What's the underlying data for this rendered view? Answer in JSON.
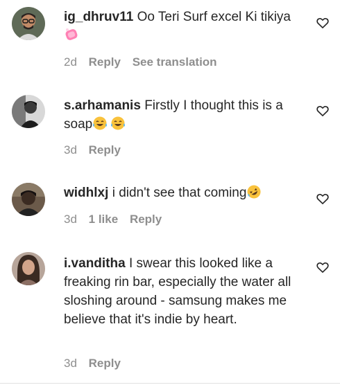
{
  "comments": [
    {
      "username": "ig_dhruv11",
      "text": "Oo Teri Surf excel Ki tikiya",
      "emoji": [
        "soap-emoji"
      ],
      "time": "2d",
      "likes": "",
      "reply_label": "Reply",
      "translate_label": "See translation",
      "avatar_icon": "user-avatar-glasses"
    },
    {
      "username": "s.arhamanis",
      "text": "Firstly I thought this is a soap",
      "emoji": [
        "tears-of-joy-emoji",
        "tears-of-joy-emoji"
      ],
      "time": "3d",
      "likes": "",
      "reply_label": "Reply",
      "avatar_icon": "user-avatar-bw"
    },
    {
      "username": "widhlxj",
      "text": "i didn't see that coming",
      "emoji": [
        "rolling-laughing-emoji"
      ],
      "time": "3d",
      "likes": "1 like",
      "reply_label": "Reply",
      "avatar_icon": "user-avatar-dark"
    },
    {
      "username": "i.vanditha",
      "text": "I swear this looked like a freaking rin bar, especially the water all sloshing around - samsung makes me believe that it's indie by heart.",
      "emoji": [],
      "time": "3d",
      "likes": "",
      "reply_label": "Reply",
      "avatar_icon": "user-avatar-portrait"
    }
  ],
  "icons": {
    "like": "heart-outline-icon"
  },
  "colors": {
    "text": "#262626",
    "meta": "#8e8e8e",
    "tears_emoji": "#f9c23c",
    "soap_emoji": "#ff80b4"
  }
}
